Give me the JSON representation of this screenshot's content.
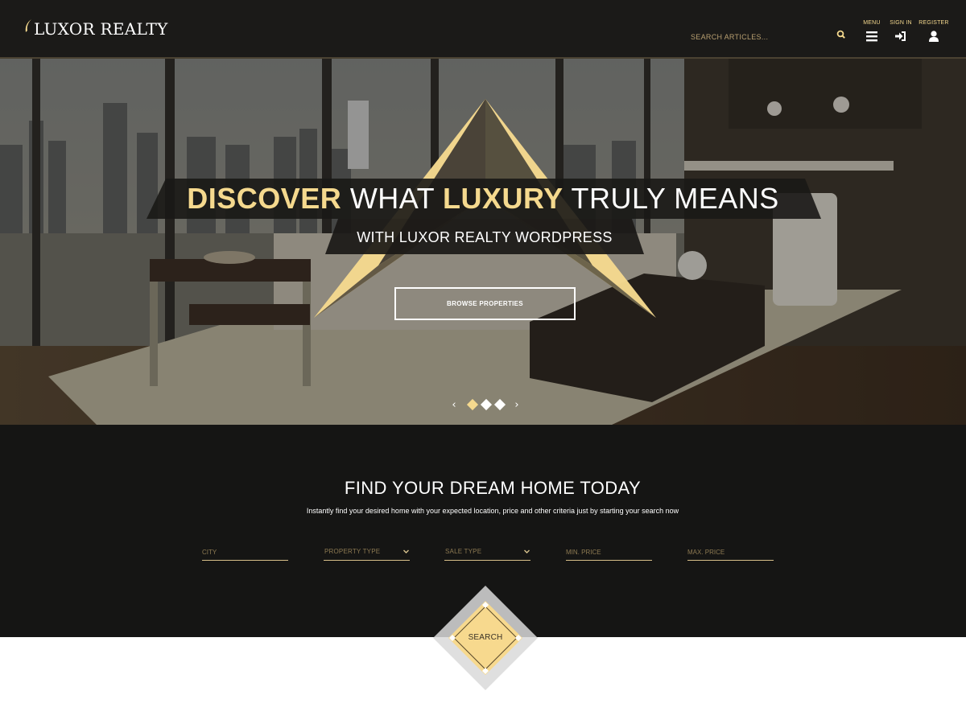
{
  "header": {
    "logo_text": "LUXOR REALTY",
    "search_placeholder": "SEARCH ARTICLES...",
    "nav": {
      "menu_label": "MENU",
      "signin_label": "SIGN IN",
      "register_label": "REGISTER"
    },
    "icons": [
      "search-icon",
      "hamburger-menu-icon",
      "sign-in-icon",
      "user-icon"
    ]
  },
  "hero": {
    "headline_strong_1": "DISCOVER",
    "headline_plain_1": "WHAT",
    "headline_strong_2": "LUXURY",
    "headline_plain_2": "TRULY MEANS",
    "subline": "WITH LUXOR REALTY WORDPRESS",
    "button_label": "BROWSE PROPERTIES",
    "slider": {
      "prev_glyph": "‹",
      "next_glyph": "›",
      "slide_count": 3,
      "active_index": 0
    }
  },
  "search_section": {
    "title": "FIND YOUR DREAM HOME TODAY",
    "subtitle": "Instantly find your desired home with your expected location, price and other criteria just by starting your search now",
    "fields": {
      "city": "CITY",
      "property_type": "PROPERTY TYPE",
      "sale_type": "SALE TYPE",
      "min_price": "MIN. PRICE",
      "max_price": "MAX. PRICE"
    },
    "search_button": "SEARCH"
  },
  "colors": {
    "accent_gold": "#f5d98e",
    "header_bg": "#1b1a18",
    "section_bg": "#151514",
    "diamond_fill": "#f7d98e",
    "dark_triangle": "#4a4338"
  }
}
